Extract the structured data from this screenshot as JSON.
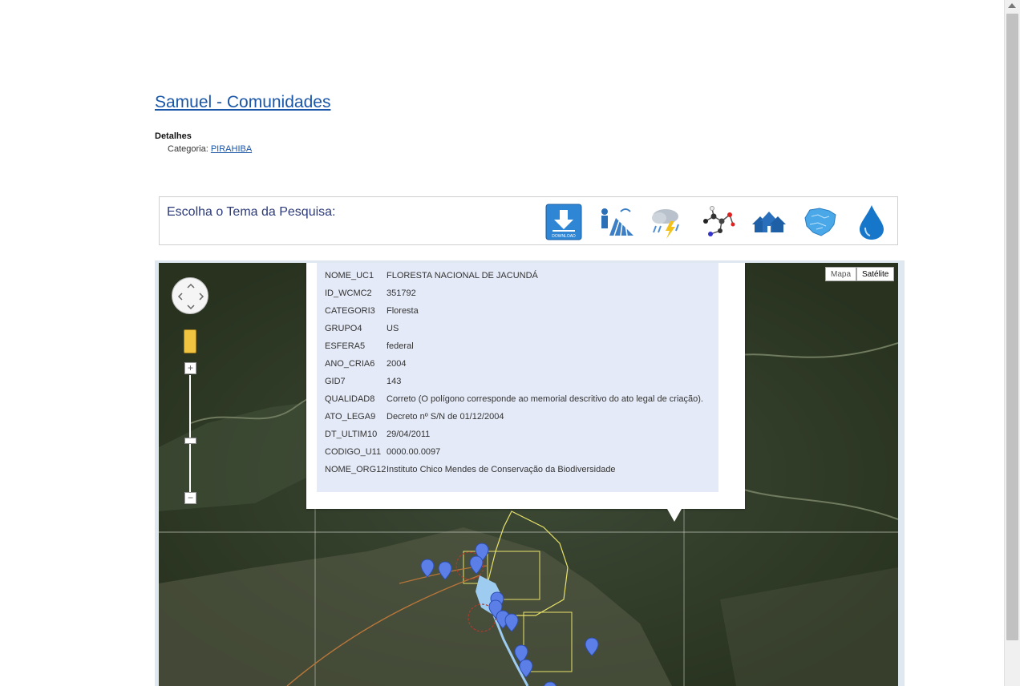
{
  "page": {
    "title": "Samuel - Comunidades",
    "details_heading": "Detalhes",
    "category_label": "Categoria:",
    "category_link": "PIRAHIBA"
  },
  "theme": {
    "label": "Escolha o Tema da Pesquisa:",
    "icons": [
      "download-icon",
      "agriculture-icon",
      "weather-icon",
      "molecule-icon",
      "community-icon",
      "region-map-icon",
      "water-drop-icon"
    ],
    "download_text": "DOWNLOAD"
  },
  "map": {
    "type_buttons": {
      "mapa": "Mapa",
      "satelite": "Satélite"
    },
    "zoom_in": "+",
    "zoom_out": "−",
    "info": [
      {
        "key": "NOME_UC1",
        "value": "FLORESTA NACIONAL DE JACUNDÁ"
      },
      {
        "key": "ID_WCMC2",
        "value": "351792"
      },
      {
        "key": "CATEGORI3",
        "value": "Floresta"
      },
      {
        "key": "GRUPO4",
        "value": "US"
      },
      {
        "key": "ESFERA5",
        "value": "federal"
      },
      {
        "key": "ANO_CRIA6",
        "value": "2004"
      },
      {
        "key": "GID7",
        "value": "143"
      },
      {
        "key": "QUALIDAD8",
        "value": "Correto (O polígono corresponde ao memorial descritivo do ato legal de criação)."
      },
      {
        "key": "ATO_LEGA9",
        "value": "Decreto nº S/N de 01/12/2004"
      },
      {
        "key": "DT_ULTIM10",
        "value": "29/04/2011"
      },
      {
        "key": "CODIGO_U11",
        "value": "0000.00.0097"
      },
      {
        "key": "NOME_ORG12",
        "value": "Instituto Chico Mendes de Conservação da Biodiversidade"
      }
    ],
    "colors": {
      "marker": "#5b7fe6",
      "boundary": "#e8e26a",
      "river": "#9ecbf0"
    }
  }
}
